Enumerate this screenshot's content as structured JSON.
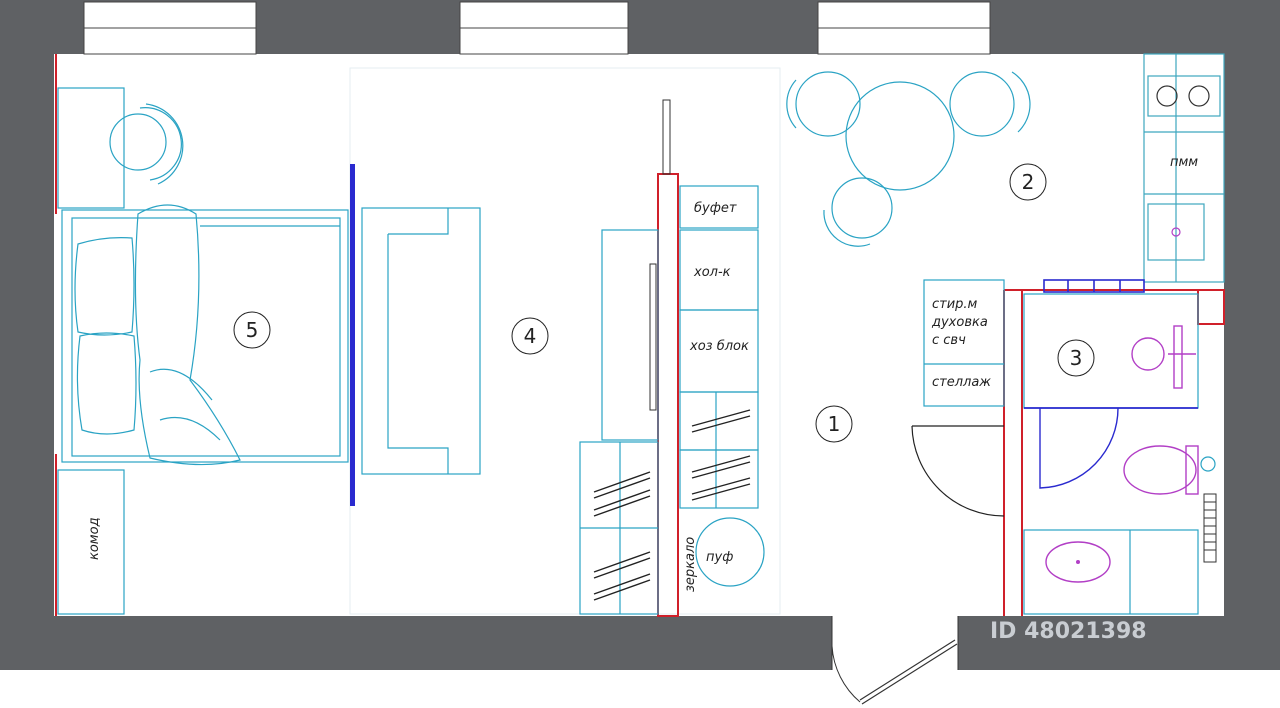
{
  "rooms": [
    {
      "number": "1"
    },
    {
      "number": "2"
    },
    {
      "number": "3"
    },
    {
      "number": "4"
    },
    {
      "number": "5"
    }
  ],
  "labels": {
    "bufet": "буфет",
    "fridge": "хол-к",
    "storage": "хоз блок",
    "washer_line1": "стир.м",
    "washer_line2": "духовка",
    "washer_line3": "с свч",
    "shelf": "стеллаж",
    "dishwasher": "пмм",
    "pouf": "пуф",
    "mirror": "зеркало",
    "dresser": "комод"
  },
  "watermark": "ID 48021398",
  "colors": {
    "wall": "#5f6164",
    "furniture": "#2aa3c4",
    "red_line": "#d0202a",
    "accent_blue": "#2a2acf",
    "purple": "#b23fc6",
    "kitchen": "#3ea7bf"
  }
}
